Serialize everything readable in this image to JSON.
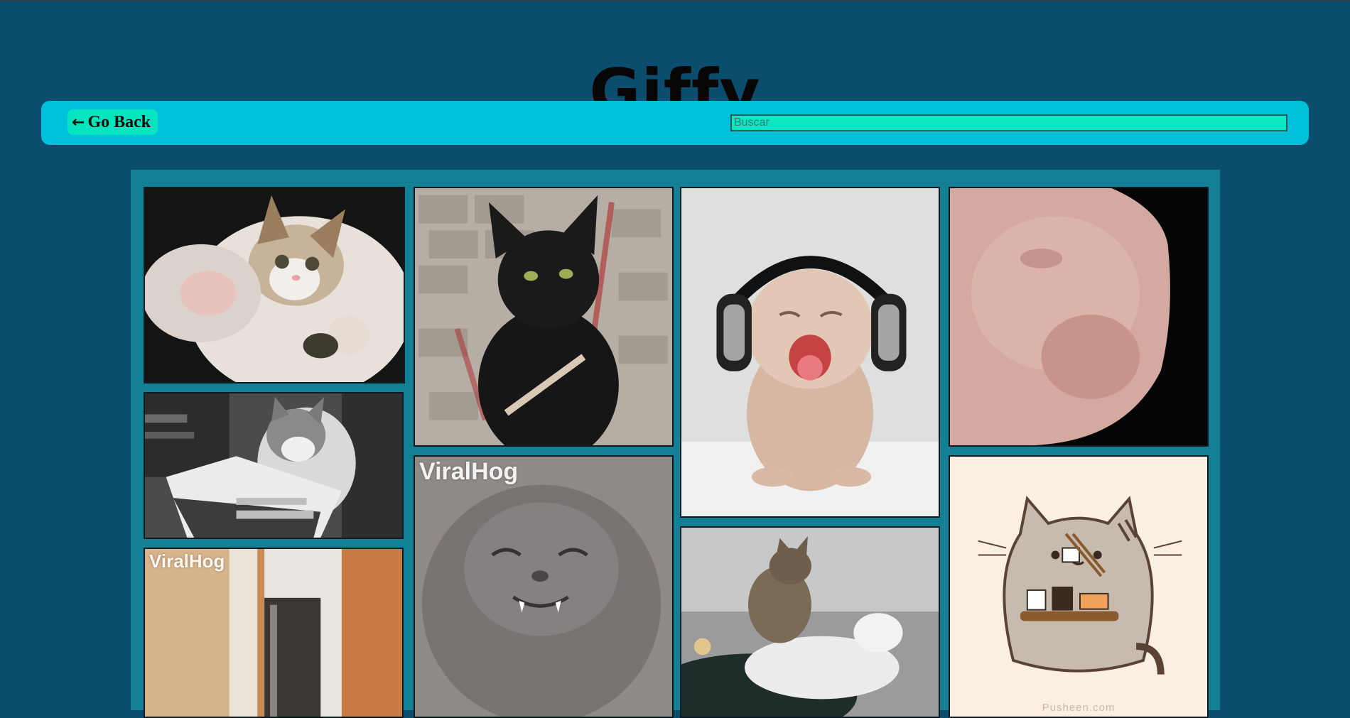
{
  "app": {
    "title": "Giffy"
  },
  "nav": {
    "back_arrow": "←",
    "back_label": "Go Back",
    "search_placeholder": "Buscar",
    "search_value": ""
  },
  "gifs": [
    {
      "id": "kitten-paw",
      "watermark": ""
    },
    {
      "id": "reading-cat",
      "watermark": ""
    },
    {
      "id": "cat-in-kitchen",
      "watermark": "ViralHog"
    },
    {
      "id": "black-cat-nail-file",
      "watermark": ""
    },
    {
      "id": "smiling-grey-cat",
      "watermark": "ViralHog"
    },
    {
      "id": "headphones-kitten",
      "watermark": ""
    },
    {
      "id": "massage-cats",
      "watermark": ""
    },
    {
      "id": "blurry-cat-closeup",
      "watermark": ""
    },
    {
      "id": "pusheen-sushi",
      "watermark": "",
      "caption": "Pusheen.com"
    }
  ],
  "colors": {
    "background": "#0b4d6d",
    "nav_bar": "#00c0dc",
    "accent": "#06e5bf",
    "gallery": "#138095"
  }
}
